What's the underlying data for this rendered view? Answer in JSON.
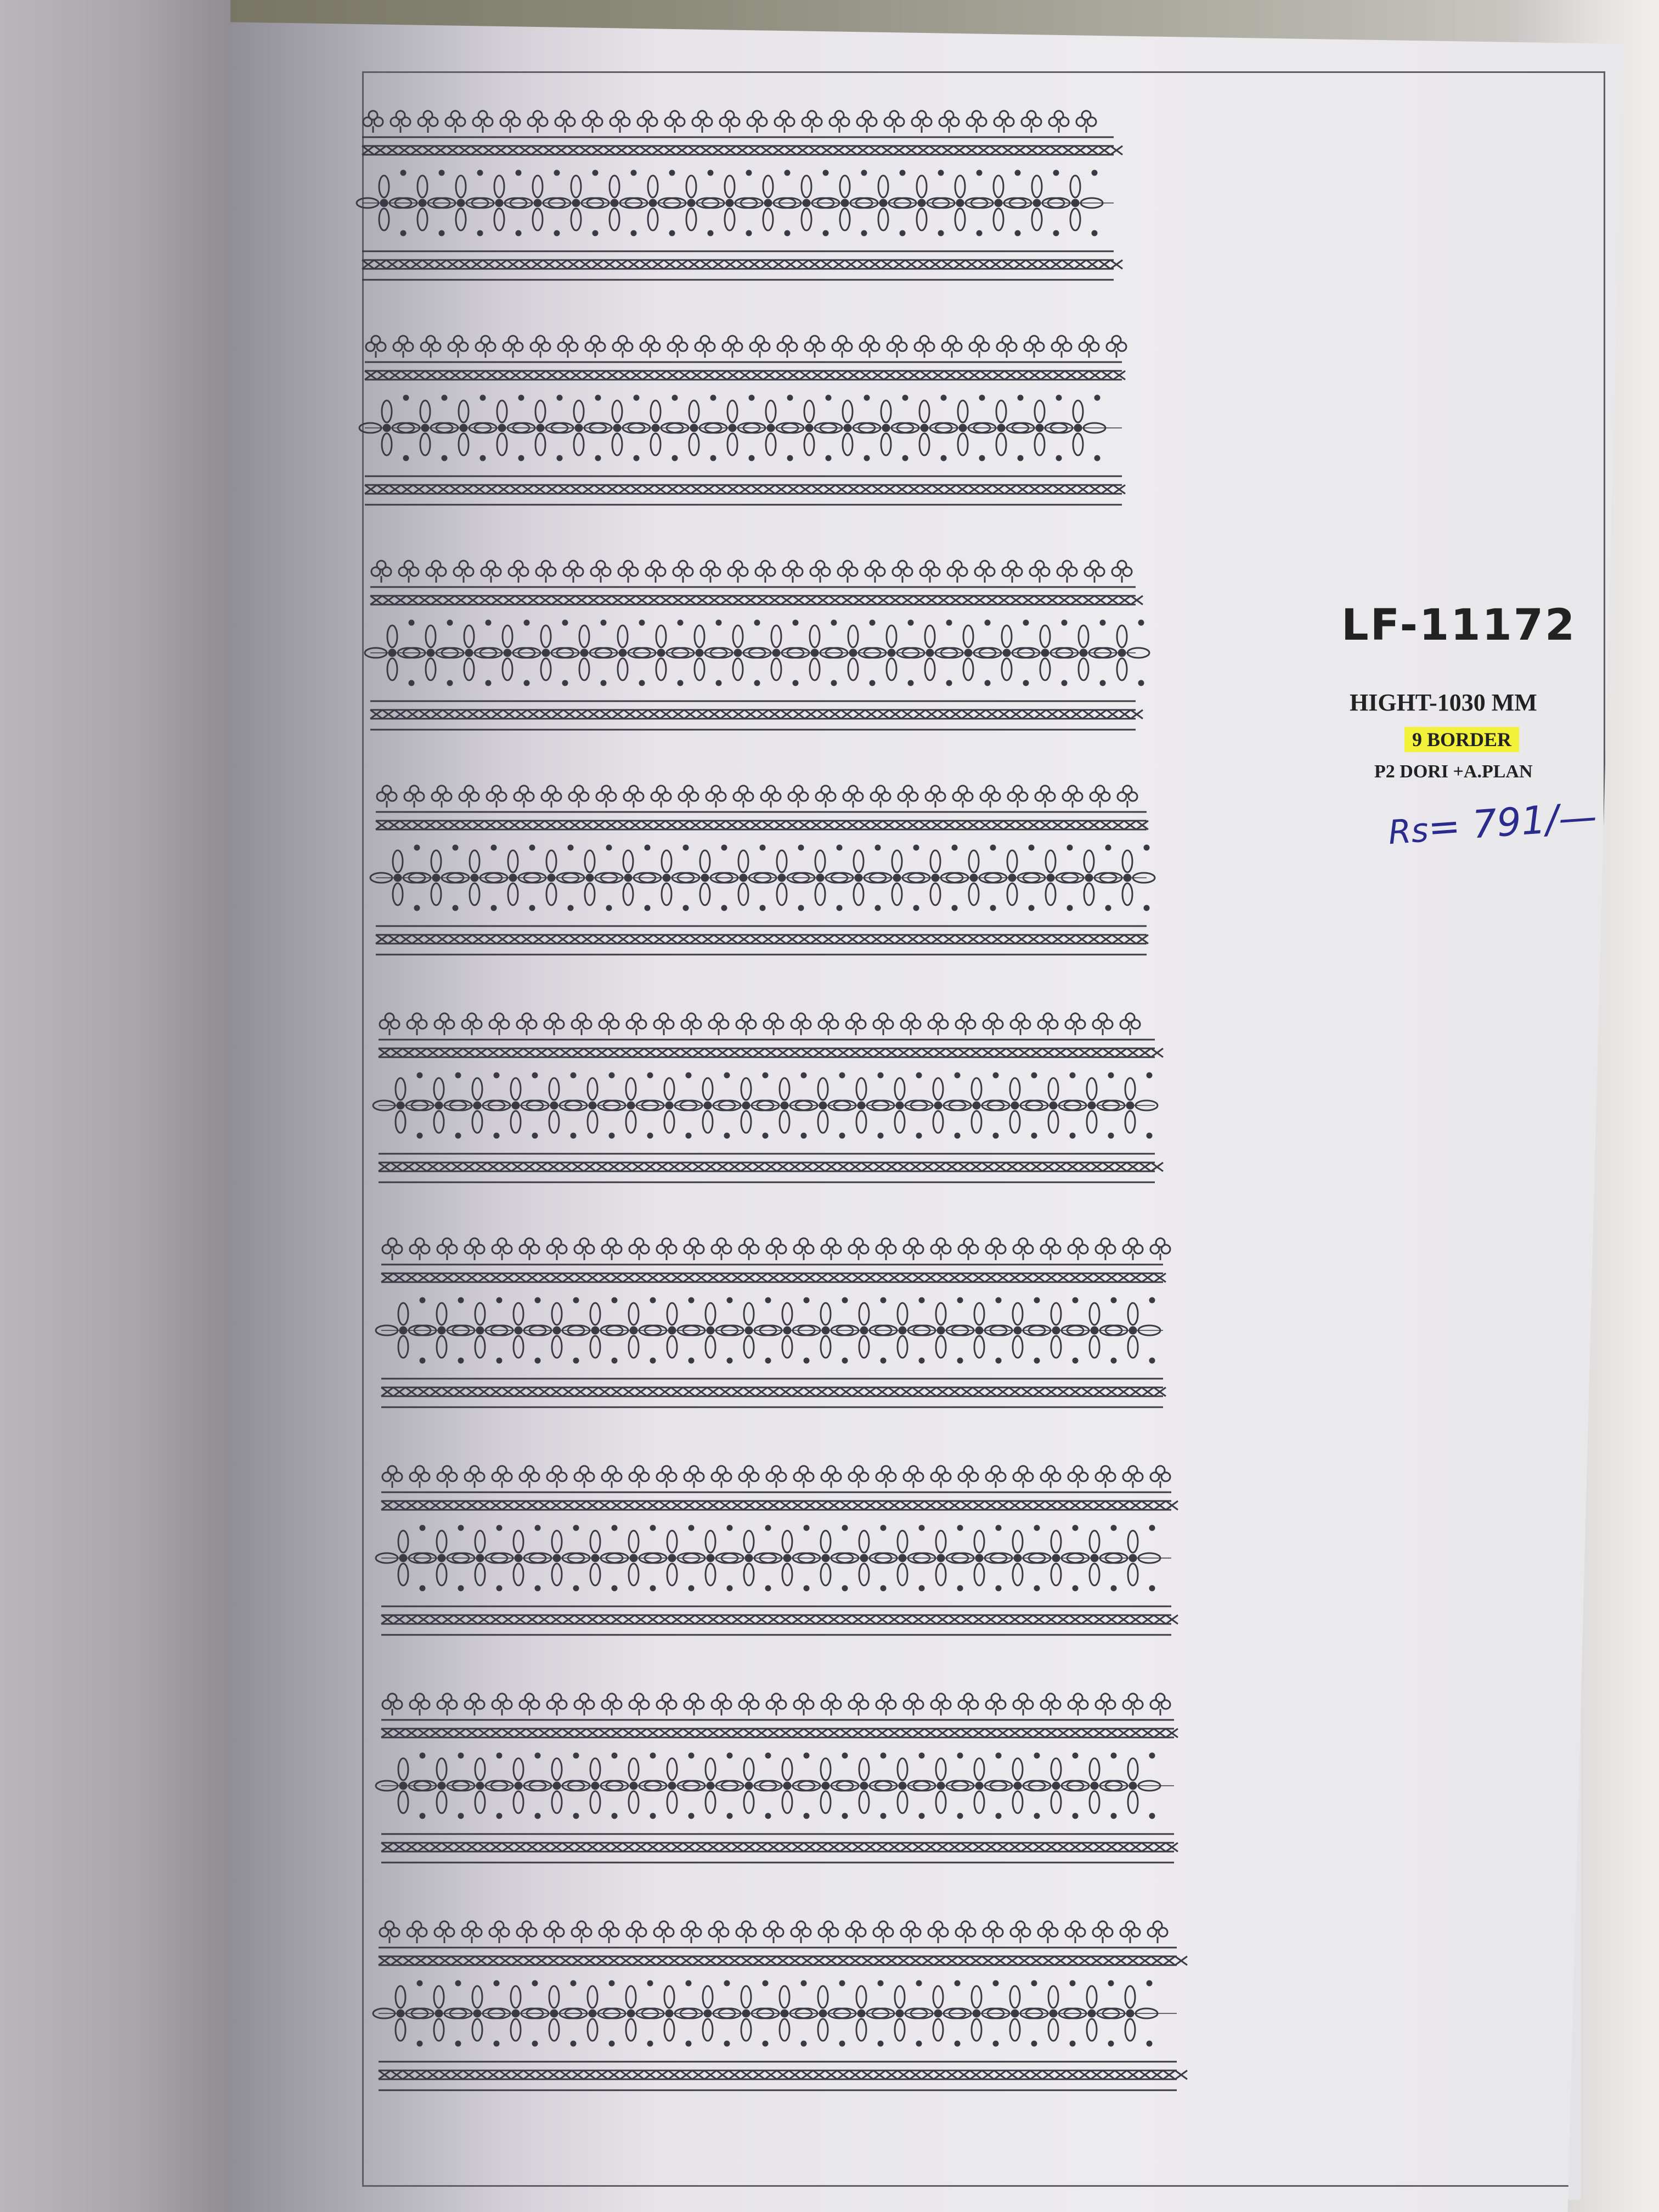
{
  "label": {
    "code": "LF-11172",
    "height": "HIGHT-1030 MM",
    "border_count": "9 BORDER",
    "spec": "P2 DORI +A.PLAN",
    "price_prefix": "Rs",
    "price": "= 791/—"
  },
  "colors": {
    "ink": "#3b3a44",
    "highlight": "#f2f23a",
    "pen": "#2a2b8c"
  }
}
